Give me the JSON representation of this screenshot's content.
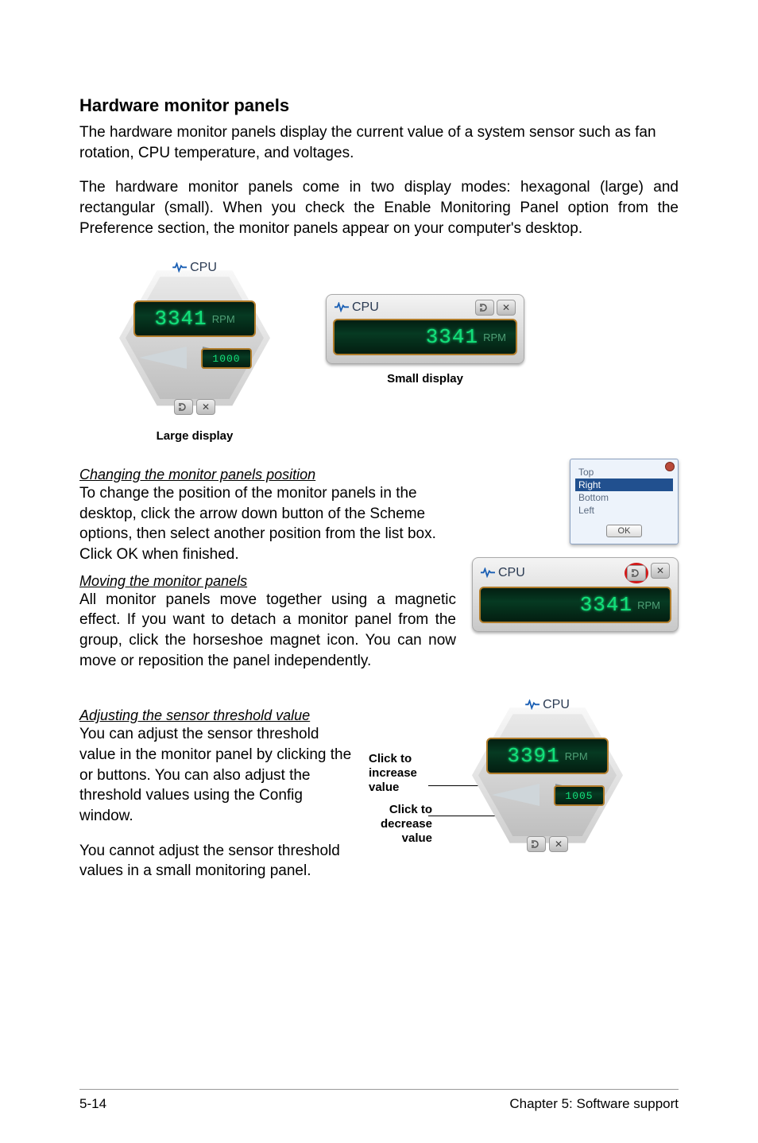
{
  "heading": "Hardware monitor panels",
  "intro1": "The hardware monitor panels display the current value of a system sensor such as fan rotation, CPU temperature, and voltages.",
  "intro2": "The hardware monitor panels come in two display modes: hexagonal (large) and rectangular (small). When you check the Enable Monitoring Panel option from the Preference section, the monitor panels appear on your computer's desktop.",
  "large_caption": "Large display",
  "small_caption": "Small display",
  "hex_panel": {
    "title": "CPU",
    "value": "3341",
    "unit": "RPM",
    "mini_value": "1000"
  },
  "small_panel": {
    "title": "CPU",
    "value": "3341",
    "unit": "RPM"
  },
  "sub1_title": "Changing the monitor panels position",
  "sub1_text": "To change the position of the monitor panels in the desktop, click the arrow down button of the Scheme options, then select another position from the list box. Click OK when finished.",
  "sub2_title": "Moving the monitor panels",
  "sub2_text1": "All monitor panels move together using a magnetic effect. If you want to detach a monitor panel from the group, click the horseshoe magnet icon. You can now move or reposition the panel independently.",
  "popup": {
    "items": [
      "Top",
      "Right",
      "Bottom",
      "Left"
    ],
    "selected": "Right",
    "ok": "OK"
  },
  "small_panel2": {
    "title": "CPU",
    "value": "3341",
    "unit": "RPM"
  },
  "sub3_title": "Adjusting the sensor threshold value",
  "sub3_text1": "You can adjust the sensor threshold value in the monitor panel by clicking the  or  buttons. You can also adjust the threshold values using the Config window.",
  "sub3_text2": "You cannot adjust the sensor threshold values in a small monitoring panel.",
  "annot_increase": "Click to increase value",
  "annot_decrease": "Click to decrease value",
  "hex_panel2": {
    "title": "CPU",
    "value": "3391",
    "unit": "RPM",
    "mini_value": "1005"
  },
  "footer_left": "5-14",
  "footer_right": "Chapter 5: Software support"
}
